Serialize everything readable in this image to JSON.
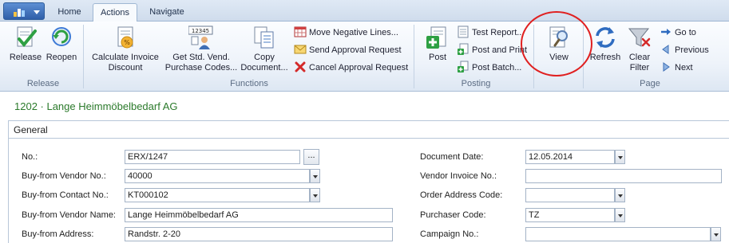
{
  "tabs": {
    "home": "Home",
    "actions": "Actions",
    "navigate": "Navigate"
  },
  "ribbon": {
    "release_group": {
      "label": "Release",
      "release": "Release",
      "reopen": "Reopen"
    },
    "functions_group": {
      "label": "Functions",
      "calc_discount_1": "Calculate Invoice",
      "calc_discount_2": "Discount",
      "get_std_1": "Get Std. Vend.",
      "get_std_2": "Purchase Codes...",
      "get_std_icon_text": "12345",
      "copy_1": "Copy",
      "copy_2": "Document...",
      "move_negative": "Move Negative Lines...",
      "send_approval": "Send Approval Request",
      "cancel_approval": "Cancel Approval Request"
    },
    "posting_group": {
      "label": "Posting",
      "post": "Post",
      "test_report": "Test Report...",
      "post_and_print": "Post and Print",
      "post_batch": "Post Batch..."
    },
    "view_group": {
      "view": "View"
    },
    "page_group": {
      "label": "Page",
      "refresh": "Refresh",
      "clear_1": "Clear",
      "clear_2": "Filter",
      "goto": "Go to",
      "previous": "Previous",
      "next": "Next"
    }
  },
  "header": {
    "title": "1202 · Lange Heimmöbelbedarf AG",
    "fasttab": "General"
  },
  "form": {
    "left": [
      {
        "label": "No.:",
        "value": "ERX/1247"
      },
      {
        "label": "Buy-from Vendor No.:",
        "value": "40000"
      },
      {
        "label": "Buy-from Contact No.:",
        "value": "KT000102"
      },
      {
        "label": "Buy-from Vendor Name:",
        "value": "Lange Heimmöbelbedarf AG"
      },
      {
        "label": "Buy-from Address:",
        "value": "Randstr. 2-20"
      }
    ],
    "right": [
      {
        "label": "Document Date:",
        "value": "12.05.2014"
      },
      {
        "label": "Vendor Invoice No.:",
        "value": ""
      },
      {
        "label": "Order Address Code:",
        "value": ""
      },
      {
        "label": "Purchaser Code:",
        "value": "TZ"
      },
      {
        "label": "Campaign No.:",
        "value": ""
      }
    ],
    "assist_button": "..."
  },
  "colors": {
    "title_green": "#2b7a2b",
    "highlight_red": "#e02020",
    "ribbon_blue": "#dde7f3"
  }
}
